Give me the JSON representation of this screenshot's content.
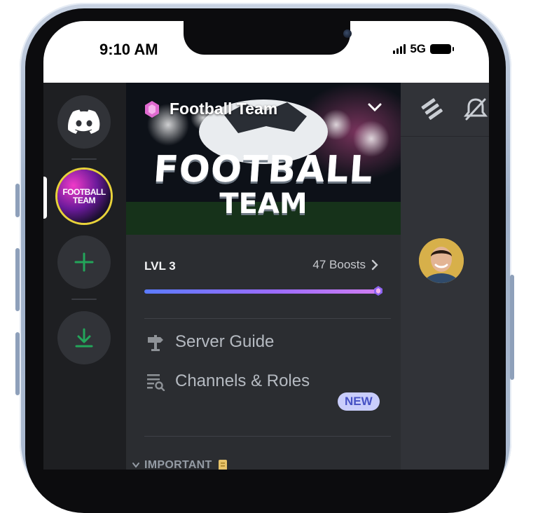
{
  "status_bar": {
    "time": "9:10 AM",
    "network": "5G"
  },
  "server_rail": {
    "items": [
      {
        "icon": "discord-icon"
      },
      {
        "icon": "server-icon",
        "label": "FOOTBALL TEAM"
      },
      {
        "icon": "plus-icon"
      },
      {
        "icon": "download-icon"
      }
    ]
  },
  "server": {
    "name": "Football Team",
    "banner_text_line1": "FOOTBALL",
    "banner_text_line2": "TEAM"
  },
  "boost": {
    "level": "LVL 3",
    "boosts": "47 Boosts",
    "progress": 1.0
  },
  "menu": {
    "server_guide": "Server Guide",
    "channels_roles": "Channels & Roles",
    "new_badge": "NEW"
  },
  "category": {
    "label": "IMPORTANT"
  },
  "colors": {
    "accent_green": "#23a55a",
    "blurple": "#5865f2",
    "badge_bg": "#c9cdfb"
  }
}
